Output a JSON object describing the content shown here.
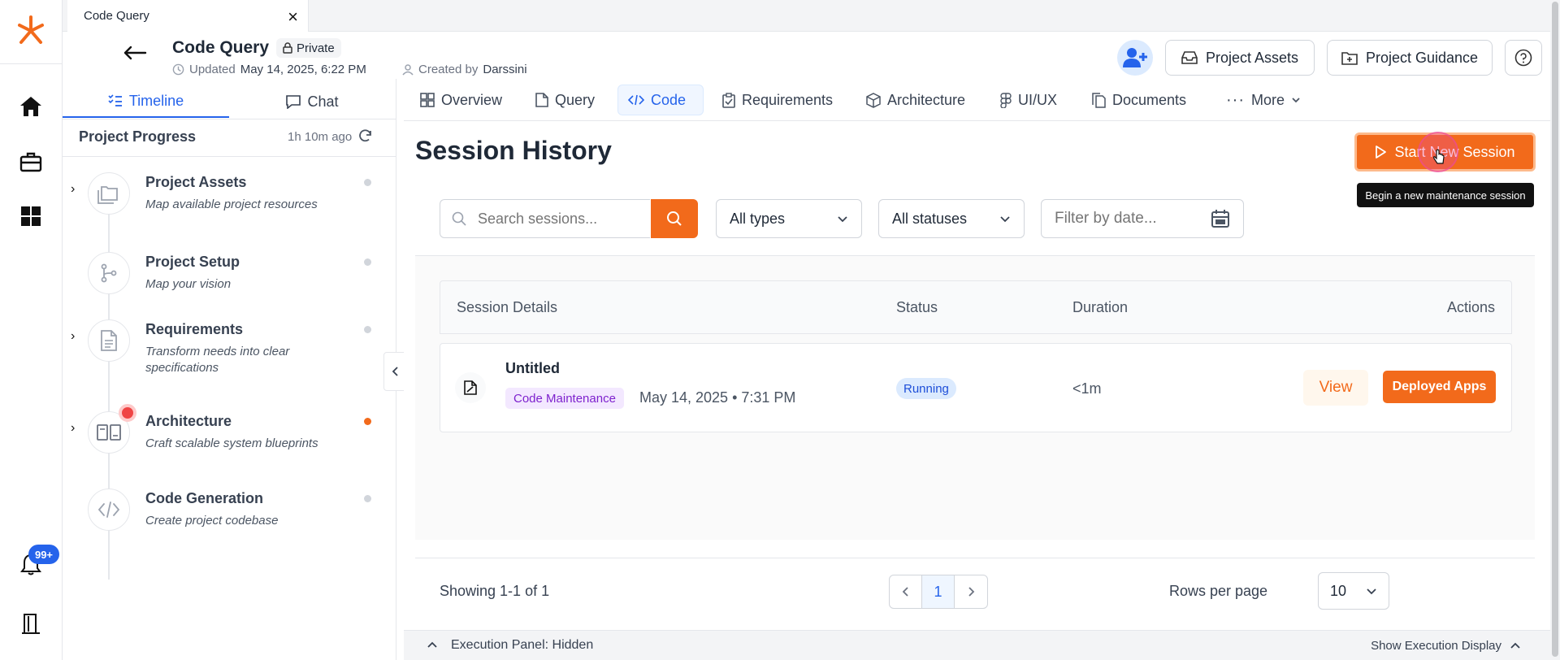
{
  "browser_tab": {
    "title": "Code Query",
    "close": "×"
  },
  "header": {
    "title": "Code Query",
    "privacy": "Private",
    "updated_label": "Updated",
    "updated_value": "May 14, 2025, 6:22 PM",
    "created_label": "Created by",
    "created_value": "Darssini",
    "project_assets_button": "Project Assets",
    "project_guidance_button": "Project Guidance"
  },
  "rail": {
    "notification_badge": "99+",
    "brand_color": "#f26a1b"
  },
  "left_panel": {
    "tabs": [
      {
        "label": "Timeline"
      },
      {
        "label": "Chat"
      }
    ],
    "progress_title": "Project Progress",
    "progress_time": "1h 10m ago",
    "steps": [
      {
        "title": "Project Assets",
        "desc": "Map available project resources"
      },
      {
        "title": "Project Setup",
        "desc": "Map your vision"
      },
      {
        "title": "Requirements",
        "desc": "Transform needs into clear specifications"
      },
      {
        "title": "Architecture",
        "desc": "Craft scalable system blueprints"
      },
      {
        "title": "Code Generation",
        "desc": "Create project codebase"
      }
    ]
  },
  "nav_tabs": [
    {
      "label": "Overview",
      "icon": "grid-icon"
    },
    {
      "label": "Query",
      "icon": "file-icon"
    },
    {
      "label": "Code",
      "icon": "code-icon"
    },
    {
      "label": "Requirements",
      "icon": "clipboard-icon"
    },
    {
      "label": "Architecture",
      "icon": "box-icon"
    },
    {
      "label": "UI/UX",
      "icon": "figma-icon"
    },
    {
      "label": "Documents",
      "icon": "documents-icon"
    },
    {
      "label": "More",
      "icon": "more-icon"
    }
  ],
  "session": {
    "heading": "Session History",
    "start_button": "Start New Session",
    "tooltip": "Begin a new maintenance session",
    "search_placeholder": "Search sessions...",
    "type_filter": "All types",
    "status_filter": "All statuses",
    "date_placeholder": "Filter by date...",
    "columns": {
      "details": "Session Details",
      "status": "Status",
      "duration": "Duration",
      "actions": "Actions"
    },
    "rows": [
      {
        "name": "Untitled",
        "tag": "Code Maintenance",
        "date": "May 14, 2025 • 7:31 PM",
        "status": "Running",
        "duration": "<1m",
        "view": "View",
        "deployed": "Deployed Apps"
      }
    ],
    "showing": "Showing 1-1 of 1",
    "page": "1",
    "rows_per_page_label": "Rows per page",
    "rows_per_page_value": "10"
  },
  "execution": {
    "label": "Execution Panel: Hidden",
    "show": "Show Execution Display"
  },
  "colors": {
    "accent": "#f26a1b",
    "active_blue": "#2563eb",
    "status_bg": "#dbeafe",
    "tag_bg": "#f3e8ff",
    "tag_text": "#7e22ce"
  }
}
